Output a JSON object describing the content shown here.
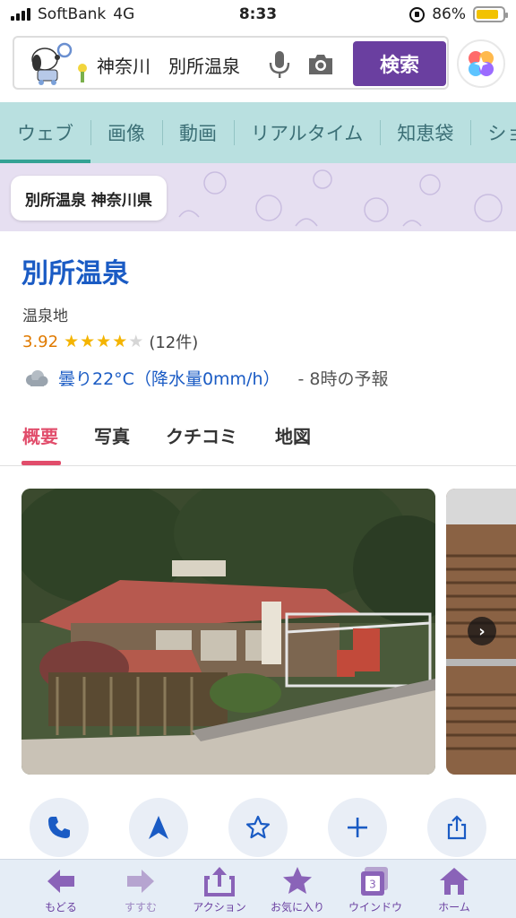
{
  "status_bar": {
    "carrier": "SoftBank",
    "network": "4G",
    "time": "8:33",
    "battery": "86%",
    "battery_level": 0.86
  },
  "search": {
    "query": "神奈川　別所温泉",
    "button_label": "検索"
  },
  "tabs": [
    "ウェブ",
    "画像",
    "動画",
    "リアルタイム",
    "知恵袋",
    "ショ"
  ],
  "active_tab": "ウェブ",
  "query_chip": "別所温泉 神奈川県",
  "place": {
    "title": "別所温泉",
    "category": "温泉地",
    "rating": "3.92",
    "rating_value": 3.92,
    "stars_filled": 4,
    "stars_total": 5,
    "review_count": "(12件)",
    "weather": "曇り22°C（降水量0mm/h）",
    "forecast": "-  8時の予報"
  },
  "detail_tabs": [
    "概要",
    "写真",
    "クチコミ",
    "地図"
  ],
  "active_detail_tab": "概要",
  "actions": [
    {
      "name": "call-button",
      "icon": "phone-icon"
    },
    {
      "name": "directions-button",
      "icon": "navigation-arrow-icon"
    },
    {
      "name": "favorite-button",
      "icon": "star-outline-icon"
    },
    {
      "name": "add-button",
      "icon": "plus-icon"
    },
    {
      "name": "share-button",
      "icon": "share-icon"
    }
  ],
  "toolbar": {
    "back": "もどる",
    "forward": "すすむ",
    "action": "アクション",
    "favorites": "お気に入り",
    "window": "ウインドウ",
    "window_count": "3",
    "home": "ホーム"
  },
  "colors": {
    "accent_purple": "#6a3fa0",
    "tab_bar": "#b9e0e0",
    "link_blue": "#1a5bc4",
    "active_pink": "#e14d6b",
    "rating_orange": "#e07a00"
  }
}
